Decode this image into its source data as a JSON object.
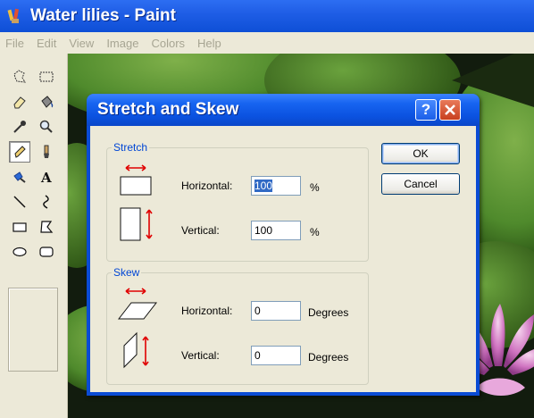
{
  "window": {
    "title": "Water lilies - Paint"
  },
  "menubar": {
    "items": [
      "File",
      "Edit",
      "View",
      "Image",
      "Colors",
      "Help"
    ]
  },
  "toolbox": {
    "tools": [
      "free-form-select",
      "rectangle-select",
      "eraser",
      "fill-with-color",
      "pick-color",
      "magnifier",
      "pencil",
      "brush",
      "airbrush",
      "text",
      "line",
      "curve",
      "rectangle",
      "polygon",
      "ellipse",
      "rounded-rectangle"
    ],
    "selected": "pencil"
  },
  "dialog": {
    "title": "Stretch and Skew",
    "help_label": "?",
    "close_label": "✕",
    "stretch": {
      "legend": "Stretch",
      "horizontal_label": "Horizontal:",
      "horizontal_value": "100",
      "horizontal_unit": "%",
      "vertical_label": "Vertical:",
      "vertical_value": "100",
      "vertical_unit": "%"
    },
    "skew": {
      "legend": "Skew",
      "horizontal_label": "Horizontal:",
      "horizontal_value": "0",
      "horizontal_unit": "Degrees",
      "vertical_label": "Vertical:",
      "vertical_value": "0",
      "vertical_unit": "Degrees"
    },
    "ok_label": "OK",
    "cancel_label": "Cancel"
  },
  "colors": {
    "titlebar": "#0e4fd6",
    "legend": "#0046d5",
    "arrow": "#e00000"
  }
}
